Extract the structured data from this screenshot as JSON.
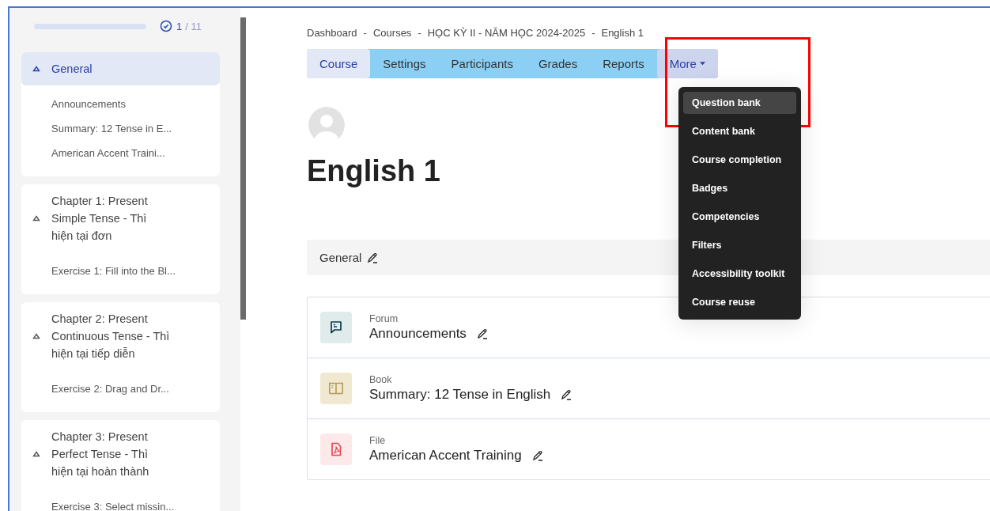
{
  "sidebar": {
    "progress": {
      "done": "1",
      "total": "/ 11"
    },
    "sections": [
      {
        "title": "General",
        "selected": true,
        "expanded": true,
        "items": [
          "Announcements",
          "Summary: 12 Tense in E...",
          "American Accent Traini..."
        ]
      },
      {
        "title": "Chapter 1: Present Simple Tense - Thì hiện tại đơn",
        "selected": false,
        "expanded": true,
        "items": [
          "Exercise 1: Fill into the Bl..."
        ]
      },
      {
        "title": "Chapter 2: Present Continuous Tense - Thì hiện tại tiếp diễn",
        "selected": false,
        "expanded": true,
        "items": [
          "Exercise 2: Drag and Dr..."
        ]
      },
      {
        "title": "Chapter 3: Present Perfect Tense - Thì hiện tại hoàn thành",
        "selected": false,
        "expanded": true,
        "items": [
          "Exercise 3: Select missin..."
        ]
      }
    ]
  },
  "breadcrumb": {
    "separator": "-",
    "items": [
      "Dashboard",
      "Courses",
      "HỌC KỲ II - NĂM HỌC 2024-2025",
      "English 1"
    ]
  },
  "tabs": [
    {
      "label": "Course",
      "kind": "link",
      "selected": true
    },
    {
      "label": "Settings",
      "kind": "link",
      "selected": false
    },
    {
      "label": "Participants",
      "kind": "link",
      "selected": false
    },
    {
      "label": "Grades",
      "kind": "link",
      "selected": false
    },
    {
      "label": "Reports",
      "kind": "link",
      "selected": false
    },
    {
      "label": "More",
      "kind": "menu",
      "selected": false,
      "expanded": true
    }
  ],
  "more_menu": [
    {
      "label": "Question bank",
      "selected": true
    },
    {
      "label": "Content bank",
      "selected": false
    },
    {
      "label": "Course completion",
      "selected": false
    },
    {
      "label": "Badges",
      "selected": false
    },
    {
      "label": "Competencies",
      "selected": false
    },
    {
      "label": "Filters",
      "selected": false
    },
    {
      "label": "Accessibility toolkit",
      "selected": false
    },
    {
      "label": "Course reuse",
      "selected": false
    }
  ],
  "course_title": "English 1",
  "section": {
    "title": "General"
  },
  "activities": [
    {
      "kind": "forum",
      "type": "Forum",
      "name": "Announcements"
    },
    {
      "kind": "book",
      "type": "Book",
      "name": "Summary: 12 Tense in English"
    },
    {
      "kind": "file",
      "type": "File",
      "name": "American Accent Training"
    }
  ]
}
